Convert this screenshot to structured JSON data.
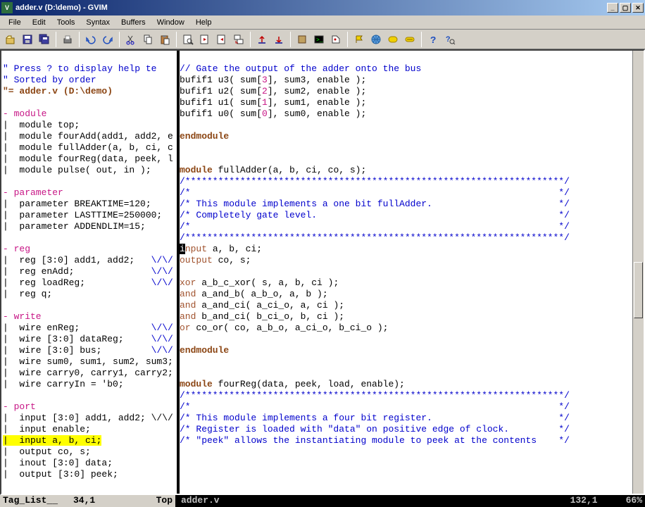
{
  "window": {
    "title": "adder.v (D:\\demo) - GVIM"
  },
  "menus": [
    "File",
    "Edit",
    "Tools",
    "Syntax",
    "Buffers",
    "Window",
    "Help"
  ],
  "left": {
    "l1": "\" Press ? to display help te",
    "l2": "\" Sorted by order",
    "l3": "\"= adder.v (D:\\demo)",
    "sec_module": "- module",
    "m1": "|  module top;",
    "m2": "|  module fourAdd(add1, add2, e",
    "m3": "|  module fullAdder(a, b, ci, c",
    "m4": "|  module fourReg(data, peek, l",
    "m5": "|  module pulse( out, in );",
    "sec_param": "- parameter",
    "p1": "|  parameter BREAKTIME=120;",
    "p2": "|  parameter LASTTIME=250000;",
    "p3": "|  parameter ADDENDLIM=15;",
    "sec_reg": "- reg",
    "r1a": "|  reg [3:0] add1, add2;   ",
    "r1b": "\\/\\/",
    "r2a": "|  reg enAdd;              ",
    "r2b": "\\/\\/",
    "r3a": "|  reg loadReg;            ",
    "r3b": "\\/\\/",
    "r4": "|  reg q;",
    "sec_wire": "- write",
    "w1a": "|  wire enReg;             ",
    "w1b": "\\/\\/",
    "w2a": "|  wire [3:0] dataReg;     ",
    "w2b": "\\/\\/",
    "w3a": "|  wire [3:0] bus;         ",
    "w3b": "\\/\\/",
    "w4": "|  wire sum0, sum1, sum2, sum3;",
    "w5": "|  wire carry0, carry1, carry2;",
    "w6": "|  wire carryIn = 'b0;",
    "sec_port": "- port",
    "po1": "|  input [3:0] add1, add2; \\/\\/",
    "po2": "|  input enable;",
    "po3": "|  input a, b, ci;",
    "po4": "|  output co, s;",
    "po5": "|  inout [3:0] data;",
    "po6": "|  output [3:0] peek;"
  },
  "right": {
    "c1": "// Gate the output of the adder onto the bus",
    "b1a": "bufif1 u3( sum[",
    "b1n": "3",
    "b1b": "], sum3, enable );",
    "b2a": "bufif1 u2( sum[",
    "b2n": "2",
    "b2b": "], sum2, enable );",
    "b3a": "bufif1 u1( sum[",
    "b3n": "1",
    "b3b": "], sum1, enable );",
    "b4a": "bufif1 u0( sum[",
    "b4n": "0",
    "b4b": "], sum0, enable );",
    "em1": "endmodule",
    "mod1a": "module",
    "mod1b": " fullAdder(a, b, ci, co, s);",
    "star1": "/*********************************************************************/",
    "cm1a": "/*                                                                   */",
    "cm2": "/* This module implements a one bit fullAdder.                       */",
    "cm3": "/* Completely gate level.                                            */",
    "cm4": "/*                                                                   */",
    "star2": "/*********************************************************************/",
    "in1a": "i",
    "in1b": "nput",
    "in1c": " a, b, ci;",
    "out1a": "output",
    "out1b": " co, s;",
    "g1a": "xor",
    "g1b": " a_b_c_xor( s, a, b, ci );",
    "g2a": "and",
    "g2b": " a_and_b( a_b_o, a, b );",
    "g3a": "and",
    "g3b": " a_and_ci( a_ci_o, a, ci );",
    "g4a": "and",
    "g4b": " b_and_ci( b_ci_o, b, ci );",
    "g5a": "or",
    "g5b": " co_or( co, a_b_o, a_ci_o, b_ci_o );",
    "em2": "endmodule",
    "mod2a": "module",
    "mod2b": " fourReg(data, peek, load, enable);",
    "star3": "/*********************************************************************/",
    "cm5": "/*                                                                   */",
    "cm6": "/* This module implements a four bit register.                       */",
    "cm7": "/* Register is loaded with \"data\" on positive edge of clock.         */",
    "cm8": "/* \"peek\" allows the instantiating module to peek at the contents    */"
  },
  "status": {
    "left_name": "Tag_List__",
    "left_pos": "34,1",
    "left_pct": "Top",
    "right_name": "adder.v",
    "right_pos": "132,1",
    "right_pct": "66%"
  }
}
